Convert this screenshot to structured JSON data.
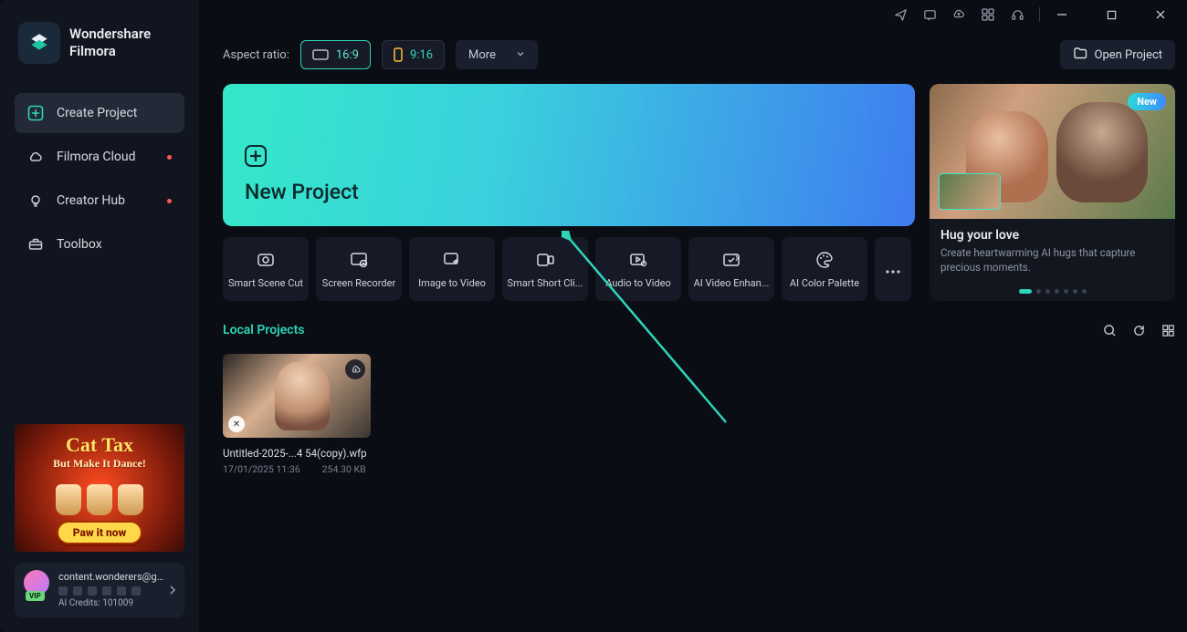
{
  "brand": {
    "line1": "Wondershare",
    "line2": "Filmora"
  },
  "sidebar": {
    "items": [
      {
        "label": "Create Project"
      },
      {
        "label": "Filmora Cloud"
      },
      {
        "label": "Creator Hub"
      },
      {
        "label": "Toolbox"
      }
    ]
  },
  "promo": {
    "title": "Cat Tax",
    "subtitle": "But Make It Dance!",
    "cta": "Paw it now"
  },
  "account": {
    "email": "content.wonderers@gmail...",
    "credits_label": "AI Credits: 101009"
  },
  "topbar": {
    "aspect_label": "Aspect ratio:",
    "ratio_a": "16:9",
    "ratio_b": "9:16",
    "more": "More",
    "open_project": "Open Project"
  },
  "newProject": {
    "title": "New Project"
  },
  "feature": {
    "badge": "New",
    "title": "Hug your love",
    "desc": "Create heartwarming AI hugs that capture precious moments."
  },
  "tools": [
    {
      "label": "Smart Scene Cut"
    },
    {
      "label": "Screen Recorder"
    },
    {
      "label": "Image to Video"
    },
    {
      "label": "Smart Short Cli..."
    },
    {
      "label": "Audio to Video"
    },
    {
      "label": "AI Video Enhan..."
    },
    {
      "label": "AI Color Palette"
    }
  ],
  "local": {
    "heading": "Local Projects",
    "projects": [
      {
        "name": "Untitled-2025-...4 54(copy).wfp",
        "date": "17/01/2025 11:36",
        "size": "254.30 KB"
      }
    ]
  }
}
